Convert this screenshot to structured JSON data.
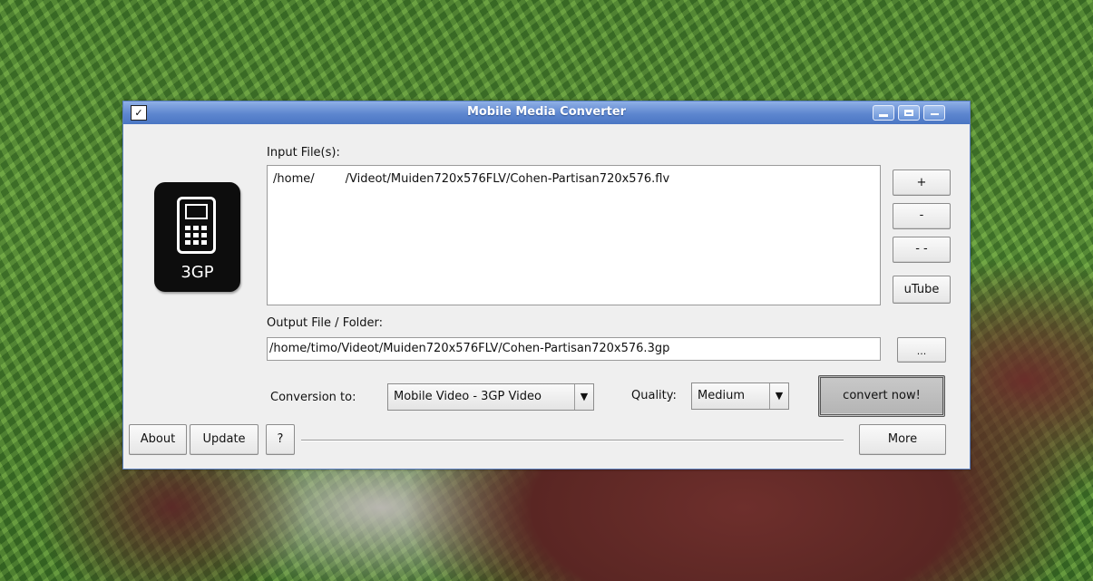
{
  "window": {
    "title": "Mobile Media Converter",
    "app_icon": "check-icon",
    "controls": [
      "minimize-icon",
      "maximize-icon",
      "close-icon"
    ]
  },
  "logo": {
    "text": "3GP",
    "icon": "mobile-phone-icon"
  },
  "input": {
    "label": "Input File(s):",
    "files": [
      {
        "part1": "/home/",
        "part2": "/Videot/Muiden720x576FLV/Cohen-Partisan720x576.flv"
      }
    ]
  },
  "side_buttons": {
    "add": "+",
    "remove": "-",
    "remove_all": "- -",
    "utube": "uTube",
    "browse": "..."
  },
  "output": {
    "label": "Output File / Folder:",
    "value": "/home/timo/Videot/Muiden720x576FLV/Cohen-Partisan720x576.3gp"
  },
  "conversion": {
    "label": "Conversion to:",
    "selected": "Mobile Video - 3GP Video"
  },
  "quality": {
    "label": "Quality:",
    "selected": "Medium"
  },
  "convert_button": "convert now!",
  "bottom": {
    "about": "About",
    "update": "Update",
    "help": "?",
    "more": "More"
  }
}
